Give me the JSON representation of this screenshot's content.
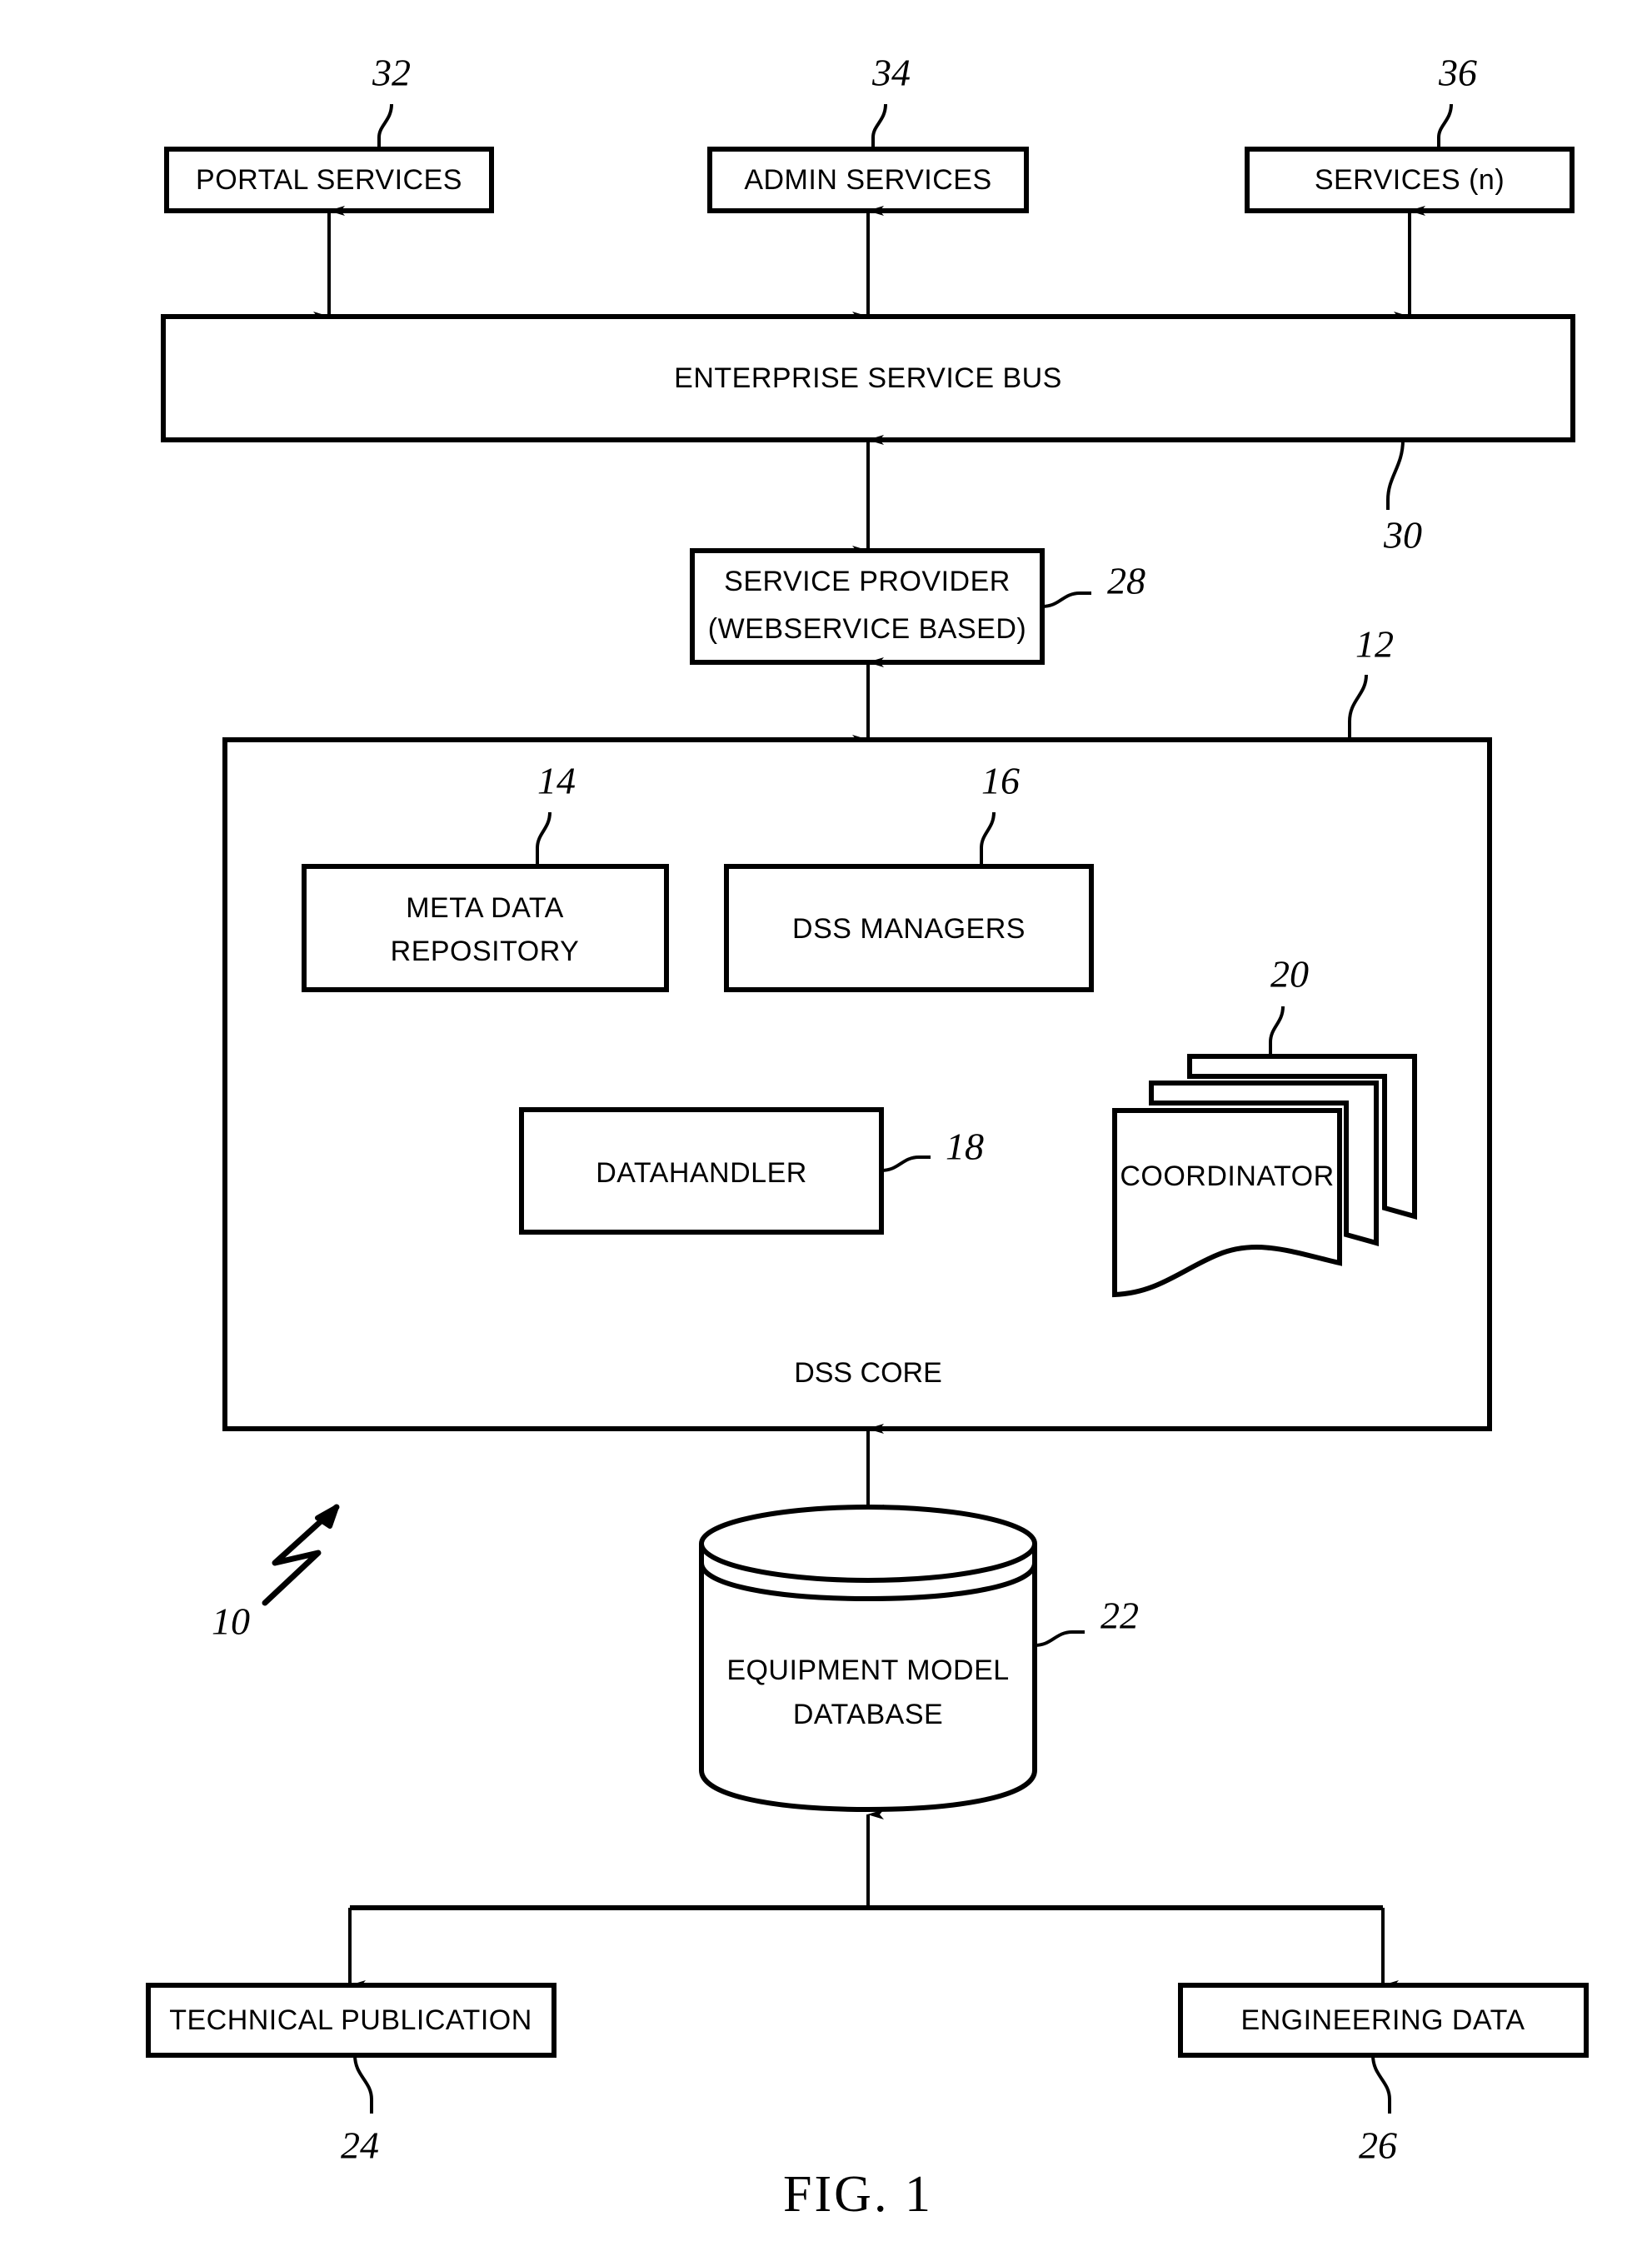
{
  "figure": {
    "caption": "FIG. 1",
    "system_ref": "10"
  },
  "top_services": [
    {
      "label": "PORTAL SERVICES",
      "ref": "32"
    },
    {
      "label": "ADMIN SERVICES",
      "ref": "34"
    },
    {
      "label": "SERVICES (n)",
      "ref": "36"
    }
  ],
  "bus": {
    "label": "ENTERPRISE SERVICE BUS",
    "ref": "30"
  },
  "service_provider": {
    "line1": "SERVICE PROVIDER",
    "line2": "(WEBSERVICE BASED)",
    "ref": "28"
  },
  "dss_core": {
    "label": "DSS CORE",
    "ref": "12",
    "components": [
      {
        "label_line1": "META DATA",
        "label_line2": "REPOSITORY",
        "ref": "14"
      },
      {
        "label_line1": "DSS MANAGERS",
        "label_line2": "",
        "ref": "16"
      },
      {
        "label_line1": "DATAHANDLER",
        "label_line2": "",
        "ref": "18"
      },
      {
        "label_line1": "COORDINATOR",
        "label_line2": "",
        "ref": "20"
      }
    ]
  },
  "database": {
    "line1": "EQUIPMENT MODEL",
    "line2": "DATABASE",
    "ref": "22"
  },
  "sources": [
    {
      "label": "TECHNICAL PUBLICATION",
      "ref": "24"
    },
    {
      "label": "ENGINEERING DATA",
      "ref": "26"
    }
  ],
  "colors": {
    "stroke": "#000000",
    "fill": "#ffffff"
  }
}
